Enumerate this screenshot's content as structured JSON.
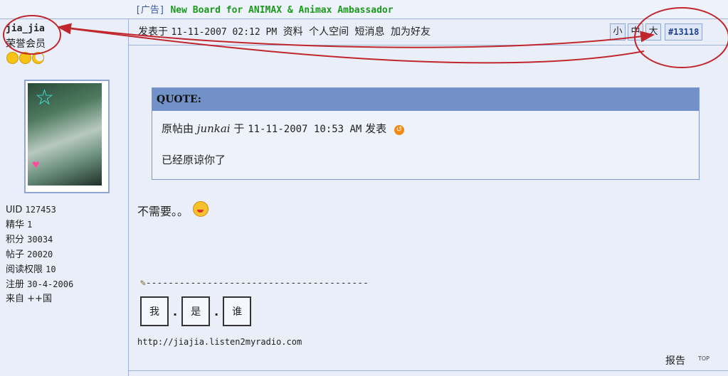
{
  "ad": {
    "tag": "[广告]",
    "link_text": "New Board for ANIMAX & Animax Ambassador"
  },
  "user": {
    "name": "jia_jia",
    "title": "荣誉会员",
    "stats": [
      {
        "label": "UID",
        "value": "127453"
      },
      {
        "label": "精华",
        "value": "1"
      },
      {
        "label": "积分",
        "value": "30034"
      },
      {
        "label": "帖子",
        "value": "20020"
      },
      {
        "label": "阅读权限",
        "value": "10"
      },
      {
        "label": "注册",
        "value": "30-4-2006"
      },
      {
        "label": "来自",
        "value": "++国"
      }
    ]
  },
  "post": {
    "posted_label": "发表于",
    "datetime": "11-11-2007 02:12 PM",
    "links": [
      "资料",
      "个人空间",
      "短消息",
      "加为好友"
    ],
    "font_buttons": [
      "小",
      "中",
      "大"
    ],
    "number": "#13118",
    "quote": {
      "header": "QUOTE:",
      "prefix": "原帖由",
      "author": "junkai",
      "on": "于",
      "datetime": "11-11-2007 10:53 AM",
      "suffix": "发表",
      "body": "已经原谅你了"
    },
    "text": "不需要。。",
    "signature": {
      "dashes": "----------------------------------------",
      "chars": [
        "我",
        "是",
        "谁"
      ],
      "sep": ".",
      "url": "http://jiajia.listen2myradio.com"
    },
    "report": "报告",
    "top": "TOP"
  },
  "colors": {
    "background": "#e9eef8",
    "quote_header": "#7191c8",
    "ad_link": "#1a9a1a",
    "annotation_red": "#c0262c"
  }
}
